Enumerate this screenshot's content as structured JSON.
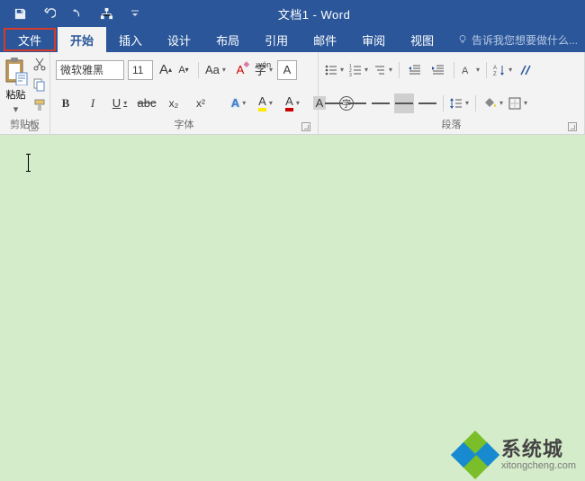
{
  "app": {
    "title": "文档1 - Word"
  },
  "tabs": {
    "file": "文件",
    "items": [
      "开始",
      "插入",
      "设计",
      "布局",
      "引用",
      "邮件",
      "审阅",
      "视图"
    ],
    "active_index": 0,
    "tell_me": "告诉我您想要做什么..."
  },
  "clipboard": {
    "paste": "粘贴",
    "label": "剪贴板"
  },
  "font": {
    "name": "微软雅黑",
    "size": "11",
    "inc": "A",
    "dec": "A",
    "case": "Aa",
    "clear_sym": "A",
    "phonetic": "字",
    "charborder": "A",
    "bold": "B",
    "italic": "I",
    "underline": "U",
    "strike": "abc",
    "sub": "x₂",
    "sup": "x²",
    "texteffects": "A",
    "highlight": "A",
    "fontcolor": "A",
    "charshade": "A",
    "enclose": "字",
    "label": "字体"
  },
  "para": {
    "label": "段落"
  },
  "watermark": {
    "text": "系统城",
    "sub": "xitongcheng.com"
  }
}
